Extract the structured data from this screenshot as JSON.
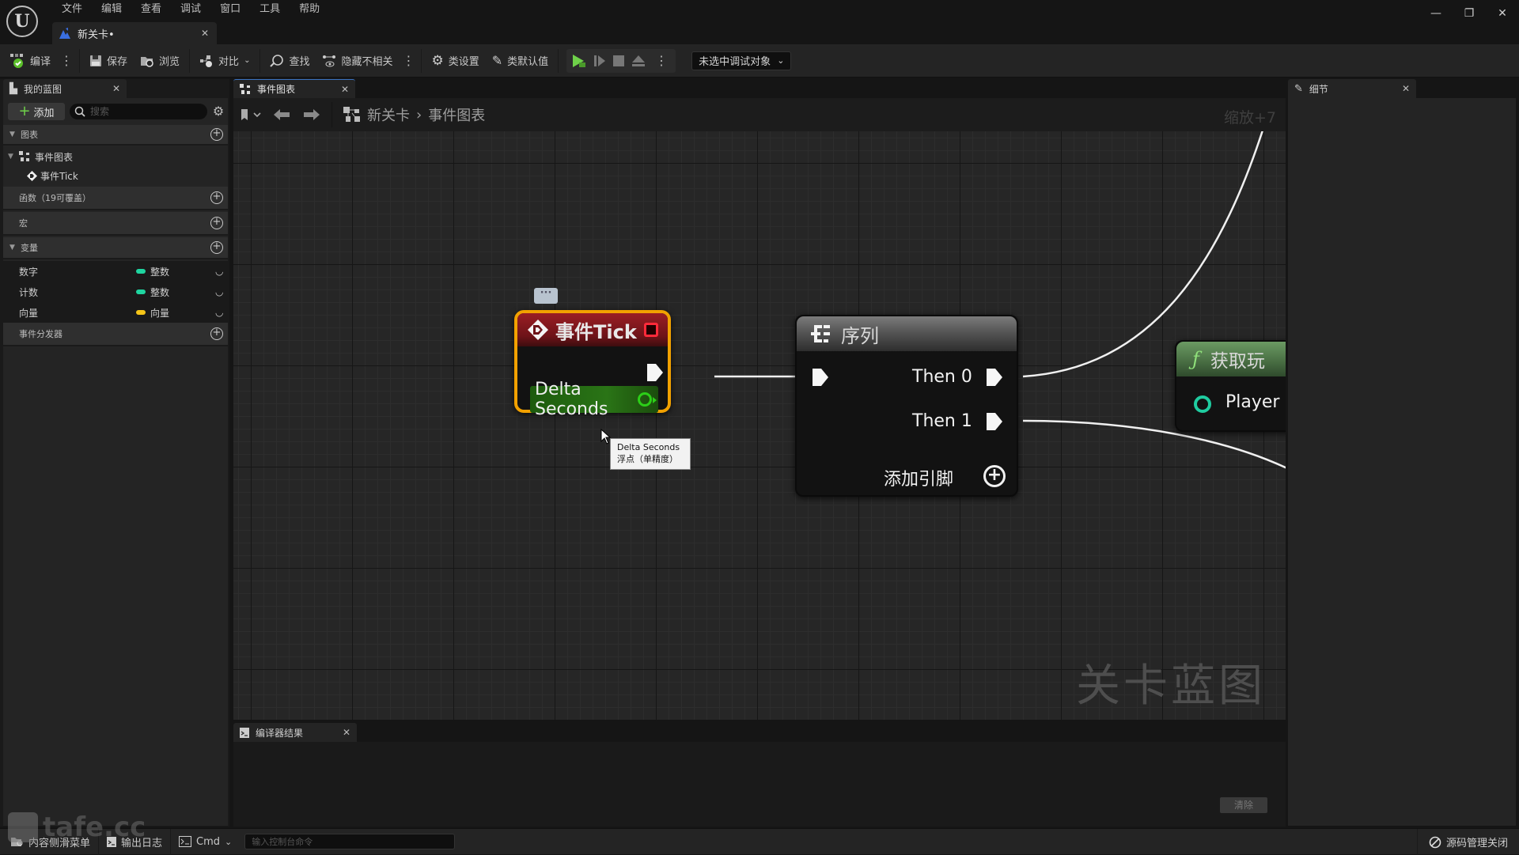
{
  "app": {
    "menu": [
      "文件",
      "编辑",
      "查看",
      "调试",
      "窗口",
      "工具",
      "帮助"
    ],
    "document_tab": "新关卡•",
    "window_controls": {
      "minimize": "minimize-icon",
      "restore": "restore-icon",
      "close": "close-icon"
    }
  },
  "toolbar": {
    "compile": "编译",
    "save": "保存",
    "browse": "浏览",
    "diff": "对比",
    "find": "查找",
    "hide_unrelated": "隐藏不相关",
    "class_settings": "类设置",
    "class_defaults": "类默认值",
    "debug_object": "未选中调试对象"
  },
  "my_blueprint": {
    "tab_label": "我的蓝图",
    "add_label": "添加",
    "search_placeholder": "搜索",
    "sections": {
      "graphs": "图表",
      "functions": "函数（19可覆盖）",
      "macros": "宏",
      "variables": "变量",
      "event_dispatchers": "事件分发器"
    },
    "graph_tree": {
      "event_graph": "事件图表",
      "event_tick": "事件Tick"
    },
    "variables": [
      {
        "name": "数字",
        "type": "整数",
        "color": "#1fd5a0"
      },
      {
        "name": "计数",
        "type": "整数",
        "color": "#1fd5a0"
      },
      {
        "name": "向量",
        "type": "向量",
        "color": "#f5c518"
      }
    ]
  },
  "graph": {
    "tab_label": "事件图表",
    "breadcrumb": [
      "新关卡",
      "事件图表"
    ],
    "zoom_label": "缩放+7",
    "watermark": "关卡蓝图",
    "nodes": {
      "event_tick": {
        "title": "事件Tick",
        "output_pin": "Delta Seconds",
        "output_pin_color": "#2ccf18",
        "header_color": "#9a1e24",
        "selection_color": "#f2a100"
      },
      "sequence": {
        "title": "序列",
        "outputs": [
          "Then 0",
          "Then 1"
        ],
        "add_pin": "添加引脚"
      },
      "get_player": {
        "title": "获取玩",
        "pin": "Player I",
        "pin_color": "#1fcca0"
      }
    },
    "tooltip": {
      "line1": "Delta Seconds",
      "line2": "浮点（单精度）"
    }
  },
  "compiler_results": {
    "tab_label": "编译器结果",
    "clear_label": "清除"
  },
  "details": {
    "tab_label": "细节"
  },
  "statusbar": {
    "content_drawer": "内容侧滑菜单",
    "output_log": "输出日志",
    "cmd": "Cmd",
    "console_placeholder": "输入控制台命令",
    "source_control": "源码管理关闭"
  },
  "overlay_watermark": "tafe.cc"
}
